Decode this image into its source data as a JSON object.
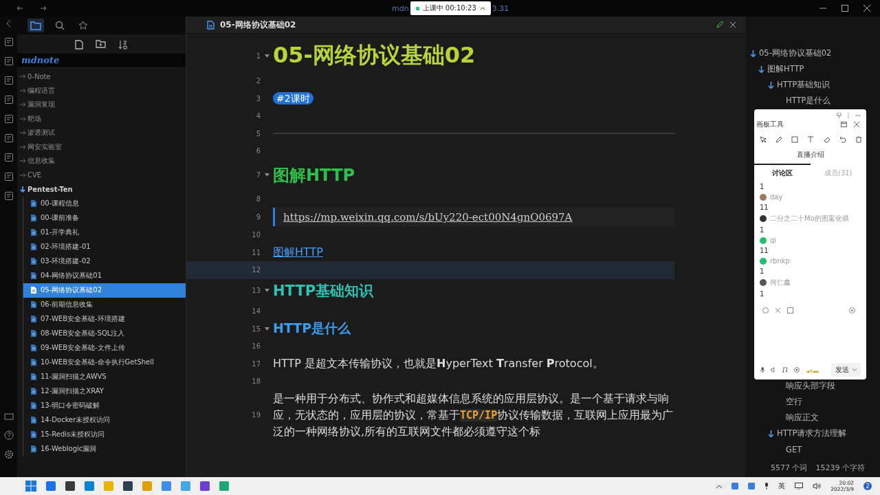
{
  "titlebar": {
    "title_start": "mdn",
    "title_end": "3.31",
    "recording": {
      "label": "上课中 00:10:23"
    }
  },
  "sidebar": {
    "tabs": [
      {
        "kind": "folder",
        "selected": true
      },
      {
        "kind": "search",
        "selected": false
      },
      {
        "kind": "star",
        "selected": false
      }
    ],
    "vault": "mdnote",
    "tree": [
      {
        "name": "0-Note",
        "expanded": false
      },
      {
        "name": "编程语言",
        "expanded": false
      },
      {
        "name": "漏洞复现",
        "expanded": false
      },
      {
        "name": "靶场",
        "expanded": false
      },
      {
        "name": "渗透测试",
        "expanded": false
      },
      {
        "name": "网安实验室",
        "expanded": false
      },
      {
        "name": "信息收集",
        "expanded": false
      },
      {
        "name": "CVE",
        "expanded": false
      },
      {
        "name": "Pentest-Ten",
        "expanded": true,
        "children": [
          {
            "name": "00-课程信息",
            "selected": false
          },
          {
            "name": "00-课前准备",
            "selected": false
          },
          {
            "name": "01-开学典礼",
            "selected": false
          },
          {
            "name": "02-环境搭建-01",
            "selected": false
          },
          {
            "name": "03-环境搭建-02",
            "selected": false
          },
          {
            "name": "04-网络协议基础01",
            "selected": false
          },
          {
            "name": "05-网络协议基础02",
            "selected": true
          },
          {
            "name": "06-前期信息收集",
            "selected": false
          },
          {
            "name": "07-WEB安全基础-环境搭建",
            "selected": false
          },
          {
            "name": "08-WEB安全基础-SQL注入",
            "selected": false
          },
          {
            "name": "09-WEB安全基础-文件上传",
            "selected": false
          },
          {
            "name": "10-WEB安全基础-命令执行GetShell",
            "selected": false
          },
          {
            "name": "11-漏洞扫描之AWVS",
            "selected": false
          },
          {
            "name": "12-漏洞扫描之XRAY",
            "selected": false
          },
          {
            "name": "13-弱口令密码破解",
            "selected": false
          },
          {
            "name": "14-Docker未授权访问",
            "selected": false
          },
          {
            "name": "15-Redis未授权访问",
            "selected": false
          },
          {
            "name": "16-Weblogic漏洞",
            "selected": false
          }
        ]
      }
    ]
  },
  "editor": {
    "tab_title": "05-网络协议基础02",
    "lines": [
      {
        "number": "1",
        "kind": "h1",
        "text": "05-网络协议基础02",
        "current": false
      },
      {
        "number": "2",
        "kind": "blank",
        "current": false
      },
      {
        "number": "3",
        "kind": "tag",
        "text": "#2课时",
        "current": false
      },
      {
        "number": "4",
        "kind": "blank",
        "current": false
      },
      {
        "number": "5",
        "kind": "hr",
        "current": false
      },
      {
        "number": "6",
        "kind": "blank",
        "current": false
      },
      {
        "number": "7",
        "kind": "h2",
        "text": "图解HTTP",
        "current": false
      },
      {
        "number": "8",
        "kind": "blank",
        "current": false
      },
      {
        "number": "9",
        "kind": "quote-link",
        "text": "https://mp.weixin.qq.com/s/bUy220-ect00N4gnO0697A",
        "current": false
      },
      {
        "number": "10",
        "kind": "blank",
        "current": false
      },
      {
        "number": "11",
        "kind": "link",
        "text": "图解HTTP",
        "current": false
      },
      {
        "number": "12",
        "kind": "blank",
        "current": true
      },
      {
        "number": "13",
        "kind": "h3",
        "text": "HTTP基础知识",
        "current": false
      },
      {
        "number": "14",
        "kind": "blank",
        "current": false
      },
      {
        "number": "15",
        "kind": "h4",
        "text": "HTTP是什么",
        "current": false
      },
      {
        "number": "16",
        "kind": "blank",
        "current": false
      },
      {
        "number": "17",
        "kind": "paragraph",
        "current": false,
        "segments": [
          {
            "kind": "text",
            "text": "HTTP 是超文本传输协议，也就是**H**yperText **T**ransfer **P**rotocol。"
          }
        ]
      },
      {
        "number": "18",
        "kind": "blank",
        "current": false
      },
      {
        "number": "19",
        "kind": "paragraph",
        "current": false,
        "segments": [
          {
            "kind": "text",
            "text": "是一种用于分布式、协作式和超媒体信息系统的应用层协议。是一个基于请求与响应，无状态的，应用层的协议，常基于"
          },
          {
            "kind": "code",
            "text": "TCP/IP"
          },
          {
            "kind": "text",
            "text": "协议传输数据，互联网上应用最为广泛的一种网络协议,所有的互联网文件都必须遵守这个标"
          }
        ]
      }
    ]
  },
  "outline": {
    "items": [
      {
        "text": "05-网络协议基础02",
        "expanded": true,
        "children": [
          {
            "text": "图解HTTP",
            "expanded": true,
            "children": [
              {
                "text": "HTTP基础知识",
                "expanded": true,
                "children": [
                  {
                    "text": "HTTP是什么"
                  },
                  {
                    "text": "响应头部字段"
                  },
                  {
                    "text": "空行"
                  },
                  {
                    "text": "响应正文"
                  }
                ]
              },
              {
                "text": "HTTP请求方法理解",
                "expanded": true,
                "children": [
                  {
                    "text": "GET"
                  }
                ]
              }
            ]
          }
        ]
      }
    ]
  },
  "chat_panel": {
    "title": "画板工具",
    "intro": "直播介绍",
    "tabs": [
      {
        "label": "讨论区",
        "selected": true
      },
      {
        "label": "成员(31)",
        "selected": false
      }
    ],
    "messages": [
      {
        "kind": "text",
        "text": "1"
      },
      {
        "kind": "user",
        "name": "day",
        "color": "#9a7a62"
      },
      {
        "kind": "text",
        "text": "11"
      },
      {
        "kind": "user",
        "name": "二分之二十Mo的图案化祺",
        "color": "#333333"
      },
      {
        "kind": "text",
        "text": "1"
      },
      {
        "kind": "user",
        "name": "qi",
        "color": "#22c06a"
      },
      {
        "kind": "text",
        "text": "11"
      },
      {
        "kind": "user",
        "name": "rbnkp",
        "color": "#22c06a"
      },
      {
        "kind": "text",
        "text": "1"
      },
      {
        "kind": "user",
        "name": "何仁鑫",
        "color": "#555555"
      },
      {
        "kind": "text",
        "text": "1"
      }
    ],
    "send_label": "发送"
  },
  "status_bar": {
    "words": "5577 个词",
    "chars": "15239 个字符"
  },
  "taskbar": {
    "language": "英",
    "time": "20:02",
    "date": "2022/3/9",
    "notifications": "2"
  }
}
